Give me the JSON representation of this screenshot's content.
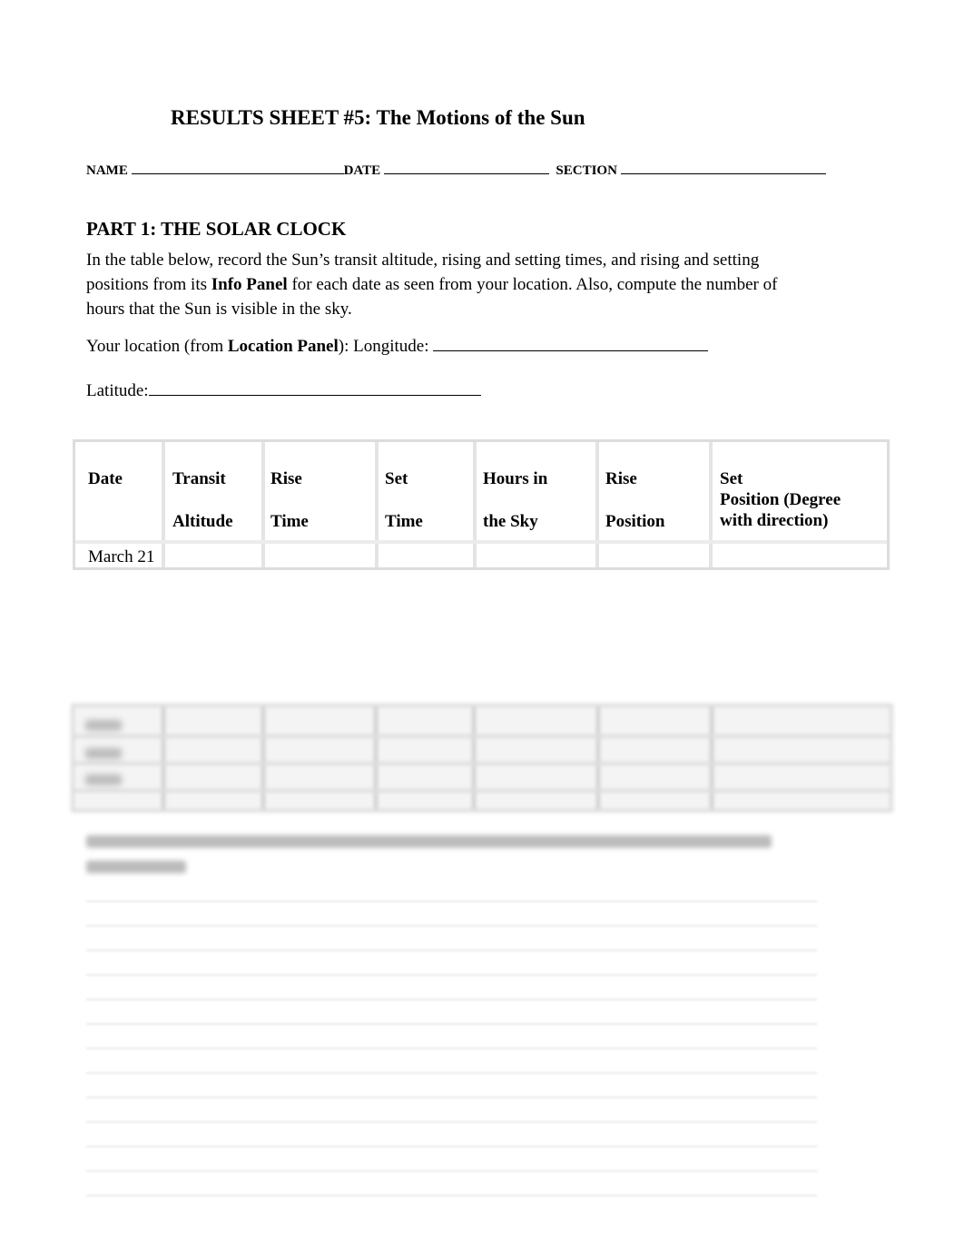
{
  "title": "RESULTS SHEET #5: The Motions of the Sun",
  "info_line": {
    "name_label": "NAME",
    "date_label": "DATE",
    "section_label": "SECTION"
  },
  "part1": {
    "heading": "PART 1: THE SOLAR CLOCK",
    "instructions_a": "In the table below, record the Sun’s transit altitude, rising and setting times, and rising and setting positions from its ",
    "instructions_bold": "Info Panel",
    "instructions_b": " for each date as seen from your location. Also, compute the number of hours that the Sun is visible in the sky.",
    "location_a": "Your location (from ",
    "location_bold": "Location Panel",
    "location_b": "): Longitude: ",
    "latitude_label": "Latitude:"
  },
  "table": {
    "headers": [
      [
        "Date",
        ""
      ],
      [
        "Transit",
        "Altitude"
      ],
      [
        "Rise",
        "Time"
      ],
      [
        "Set",
        "Time"
      ],
      [
        "Hours in",
        "the Sky"
      ],
      [
        "Rise",
        "Position"
      ],
      [
        "Set\nPosition (Degree",
        "with direction)"
      ]
    ],
    "first_row_date": "March 21"
  }
}
